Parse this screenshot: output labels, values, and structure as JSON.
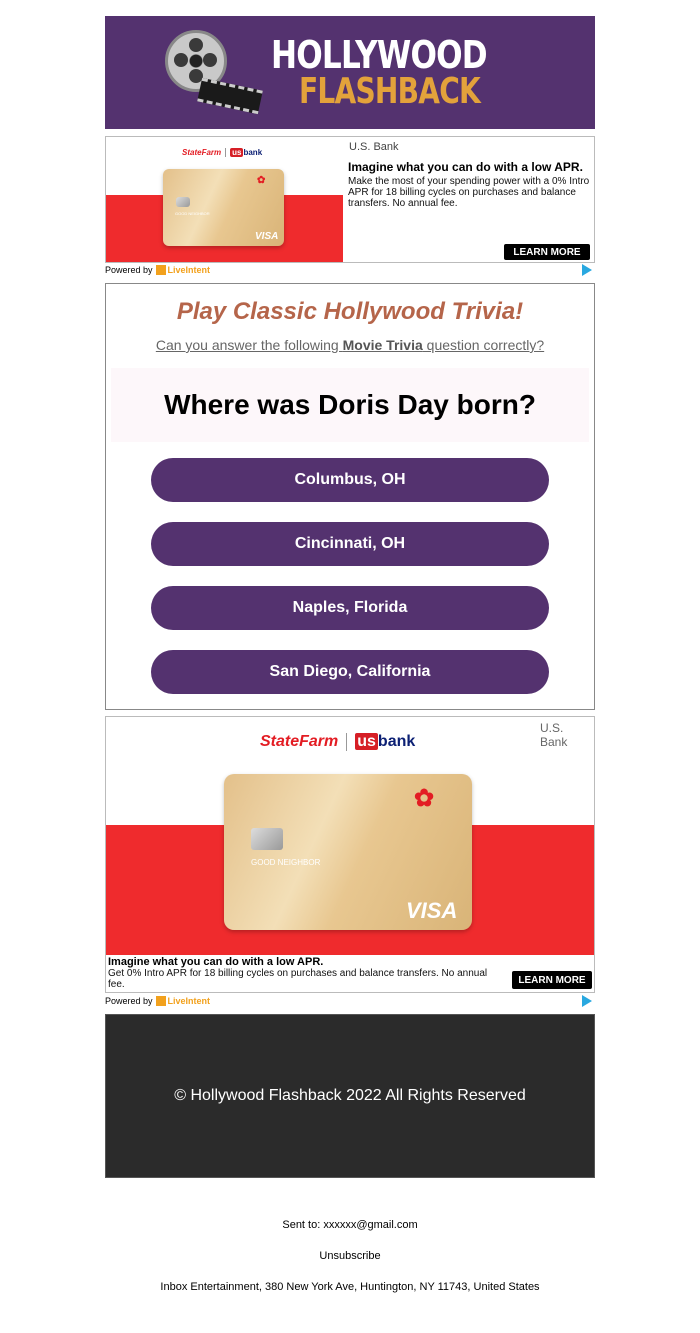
{
  "header": {
    "logo_top": "HOLLYWOOD",
    "logo_bottom": "FLASHBACK",
    "bg_color": "#54326f"
  },
  "ad_top": {
    "brand": "U.S. Bank",
    "logos": {
      "statefarm": "StateFarm",
      "usbank_us": "us",
      "usbank_bank": "bank"
    },
    "card_label": "GOOD NEIGHBOR",
    "card_network": "VISA",
    "headline": "Imagine what you can do with a low APR.",
    "body": "Make the most of your spending power with a 0% Intro APR for 18 billing cycles on purchases and balance transfers. No annual fee.",
    "cta": "LEARN MORE",
    "powered_by": "Powered by",
    "liveintent": "LiveIntent"
  },
  "trivia": {
    "title": "Play Classic Hollywood Trivia!",
    "subtitle_pre": "Can you answer the following ",
    "subtitle_bold": "Movie Trivia",
    "subtitle_post": " question correctly?",
    "question": "Where was Doris Day born?",
    "answers": [
      "Columbus, OH",
      "Cincinnati, OH",
      "Naples, Florida",
      "San Diego, California"
    ],
    "button_color": "#54326f"
  },
  "ad_bottom": {
    "brand": "U.S. Bank",
    "logos": {
      "statefarm": "StateFarm",
      "usbank_us": "us",
      "usbank_bank": "bank"
    },
    "card_label": "GOOD NEIGHBOR",
    "card_network": "VISA",
    "headline": "Imagine what you can do with a low APR.",
    "body": "Get 0% Intro APR for 18 billing cycles on purchases and balance transfers. No annual fee.",
    "cta": "LEARN MORE",
    "powered_by": "Powered by",
    "liveintent": "LiveIntent"
  },
  "footer": {
    "copyright": "© Hollywood Flashback 2022 All Rights Reserved",
    "sent_to": "Sent to: xxxxxx@gmail.com",
    "unsubscribe": "Unsubscribe",
    "address": "Inbox Entertainment, 380 New York Ave, Huntington, NY 11743, United States"
  }
}
